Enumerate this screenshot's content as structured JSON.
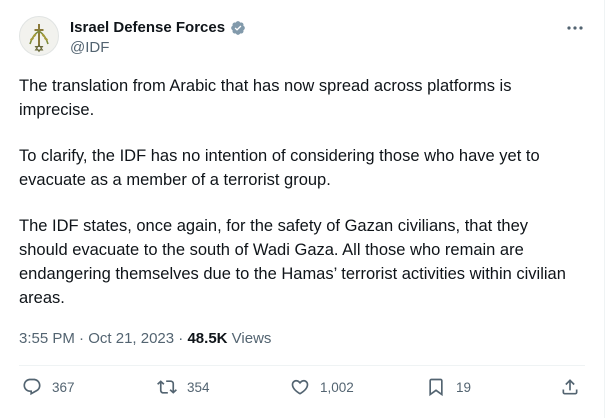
{
  "author": {
    "display_name": "Israel Defense Forces",
    "handle": "@IDF",
    "verified_badge_color": "#829aab"
  },
  "tweet": {
    "paragraphs": [
      "The translation from Arabic that has now spread across platforms is imprecise.",
      "To clarify, the IDF has no intention of considering those who have yet to evacuate as a member of a terrorist group.",
      "The IDF states, once again, for the safety of Gazan civilians, that they should evacuate to the south of Wadi Gaza. All those who remain are endangering themselves due to the Hamas’ terrorist activities within civilian areas."
    ],
    "time": "3:55 PM",
    "separator": "·",
    "date": "Oct 21, 2023",
    "views_count": "48.5K",
    "views_label": "Views"
  },
  "actions": {
    "replies": "367",
    "reposts": "354",
    "likes": "1,002",
    "bookmarks": "19"
  },
  "colors": {
    "text": "#0f1419",
    "secondary": "#536471",
    "divider": "#eff3f4"
  }
}
